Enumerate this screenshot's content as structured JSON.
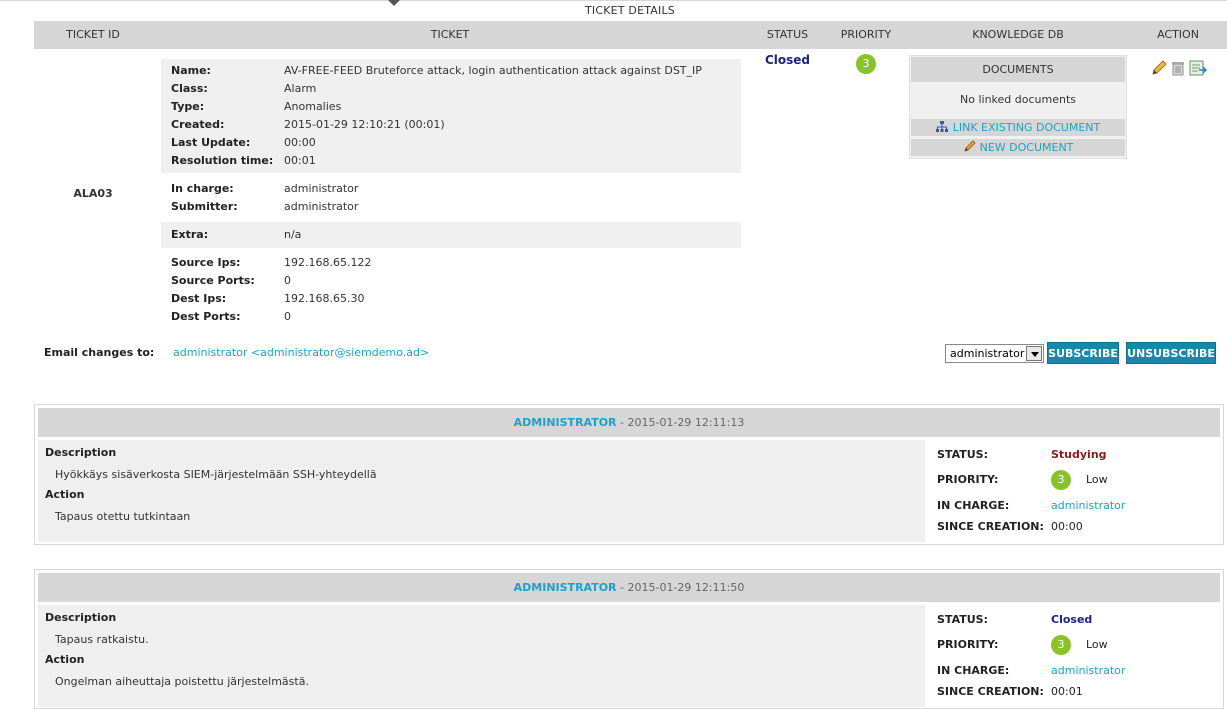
{
  "page_title": "TICKET DETAILS",
  "columns": [
    "TICKET ID",
    "TICKET",
    "STATUS",
    "PRIORITY",
    "KNOWLEDGE DB",
    "ACTION"
  ],
  "ticket": {
    "id": "ALA03",
    "fields_group1": [
      {
        "label": "Name:",
        "value": "AV-FREE-FEED Bruteforce attack, login authentication attack against DST_IP"
      },
      {
        "label": "Class:",
        "value": "Alarm"
      },
      {
        "label": "Type:",
        "value": "Anomalies"
      },
      {
        "label": "Created:",
        "value": "2015-01-29 12:10:21 (00:01)"
      },
      {
        "label": "Last Update:",
        "value": "00:00"
      },
      {
        "label": "Resolution time:",
        "value": "00:01"
      }
    ],
    "fields_group2": [
      {
        "label": "In charge:",
        "value": "administrator"
      },
      {
        "label": "Submitter:",
        "value": "administrator"
      }
    ],
    "fields_group3": [
      {
        "label": "Extra:",
        "value": "n/a"
      }
    ],
    "fields_group4": [
      {
        "label": "Source Ips:",
        "value": "192.168.65.122"
      },
      {
        "label": "Source Ports:",
        "value": "0"
      },
      {
        "label": "Dest Ips:",
        "value": "192.168.65.30"
      },
      {
        "label": "Dest Ports:",
        "value": "0"
      }
    ],
    "status": "Closed",
    "priority": "3"
  },
  "knowledge_db": {
    "header": "DOCUMENTS",
    "empty_text": "No linked documents",
    "link_existing": "LINK EXISTING DOCUMENT",
    "new_document": "NEW DOCUMENT"
  },
  "actions": {
    "icons": [
      "edit-icon",
      "delete-icon",
      "export-icon"
    ]
  },
  "email": {
    "label": "Email changes to:",
    "value": "administrator <administrator@siemdemo.ad>",
    "select_value": "administrator",
    "subscribe": "SUBSCRIBE",
    "unsubscribe": "UNSUBSCRIBE"
  },
  "history": [
    {
      "author": "ADMINISTRATOR",
      "date": " - 2015-01-29 12:11:13",
      "description_label": "Description",
      "description": "Hyökkäys sisäverkosta SIEM-järjestelmään SSH-yhteydellä",
      "action_label": "Action",
      "action": "Tapaus otettu tutkintaan",
      "status_label": "STATUS:",
      "status": "Studying",
      "priority_label": "PRIORITY:",
      "priority_num": "3",
      "priority_text": "Low",
      "in_charge_label": "IN CHARGE:",
      "in_charge": "administrator",
      "since_label": "SINCE CREATION:",
      "since": "00:00"
    },
    {
      "author": "ADMINISTRATOR",
      "date": " - 2015-01-29 12:11:50",
      "description_label": "Description",
      "description": "Tapaus ratkaistu.",
      "action_label": "Action",
      "action": "Ongelman aiheuttaja poistettu järjestelmästä.",
      "status_label": "STATUS:",
      "status": "Closed",
      "priority_label": "PRIORITY:",
      "priority_num": "3",
      "priority_text": "Low",
      "in_charge_label": "IN CHARGE:",
      "in_charge": "administrator",
      "since_label": "SINCE CREATION:",
      "since": "00:01"
    }
  ],
  "colors": {
    "header_bg": "#d6d6d6",
    "link": "#1da1c9",
    "button": "#1887a8",
    "priority_green": "#8ac22a",
    "status_closed": "#1a237e",
    "status_studying": "#8b1a1a"
  }
}
